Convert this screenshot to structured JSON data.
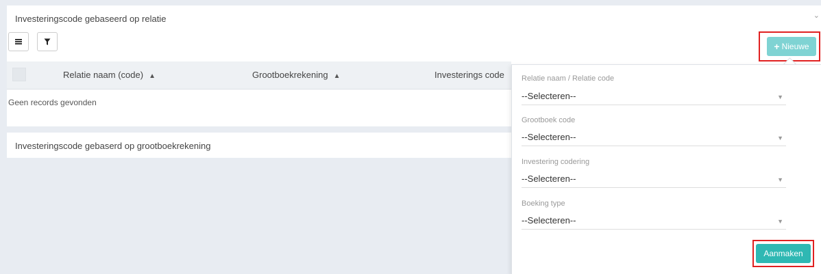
{
  "panel1": {
    "title": "Investeringscode gebaseerd op relatie",
    "table": {
      "columns": [
        "Relatie naam (code)",
        "Grootboekrekening",
        "Investerings code"
      ],
      "empty_text": "Geen records gevonden"
    },
    "new_button_label": "Nieuwe"
  },
  "panel2": {
    "title": "Investeringscode gebaserd op grootboekrekening"
  },
  "form": {
    "fields": [
      {
        "label": "Relatie naam / Relatie code",
        "value": "--Selecteren--"
      },
      {
        "label": "Grootboek code",
        "value": "--Selecteren--"
      },
      {
        "label": "Investering codering",
        "value": "--Selecteren--"
      },
      {
        "label": "Boeking type",
        "value": "--Selecteren--"
      }
    ],
    "submit_label": "Aanmaken"
  },
  "colors": {
    "accent": "#2fb8b3",
    "accent_light": "#7fd3d3",
    "highlight": "#e02020",
    "background": "#e8ecf2"
  }
}
